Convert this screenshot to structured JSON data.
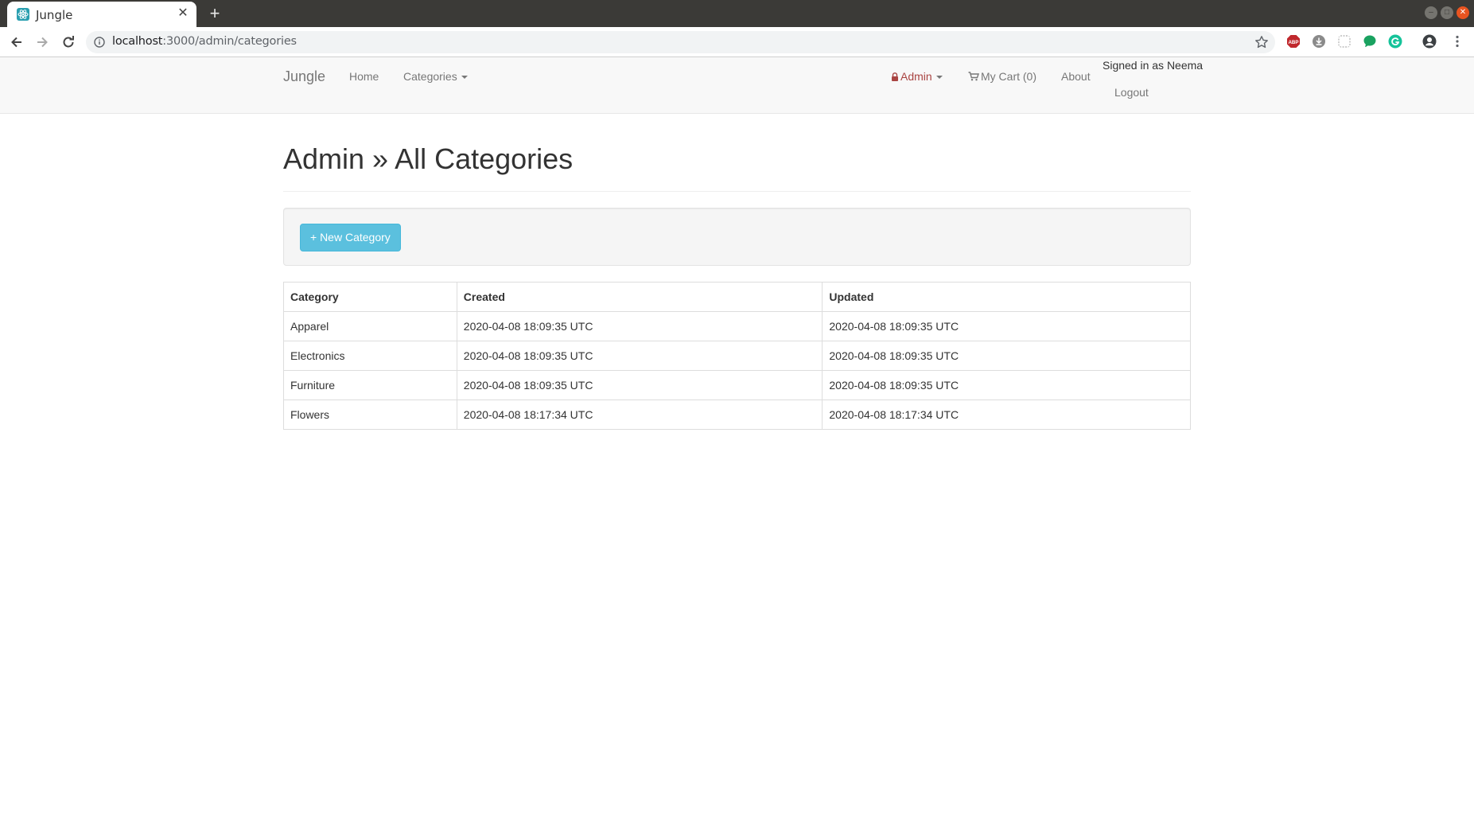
{
  "browser": {
    "tab_title": "Jungle",
    "url_host": "localhost",
    "url_rest": ":3000/admin/categories",
    "colors": {
      "titlebar": "#3b3a37",
      "close_button": "#e95420"
    }
  },
  "navbar": {
    "brand": "Jungle",
    "home": "Home",
    "categories": "Categories",
    "admin": "Admin",
    "cart": "My Cart (0)",
    "about": "About",
    "signed_in": "Signed in as Neema",
    "logout": "Logout",
    "admin_color": "#a94442"
  },
  "main": {
    "title": "Admin » All Categories",
    "new_button": "+ New Category",
    "table": {
      "headers": [
        "Category",
        "Created",
        "Updated"
      ],
      "rows": [
        [
          "Apparel",
          "2020-04-08 18:09:35 UTC",
          "2020-04-08 18:09:35 UTC"
        ],
        [
          "Electronics",
          "2020-04-08 18:09:35 UTC",
          "2020-04-08 18:09:35 UTC"
        ],
        [
          "Furniture",
          "2020-04-08 18:09:35 UTC",
          "2020-04-08 18:09:35 UTC"
        ],
        [
          "Flowers",
          "2020-04-08 18:17:34 UTC",
          "2020-04-08 18:17:34 UTC"
        ]
      ]
    },
    "button_color": "#5bc0de"
  }
}
